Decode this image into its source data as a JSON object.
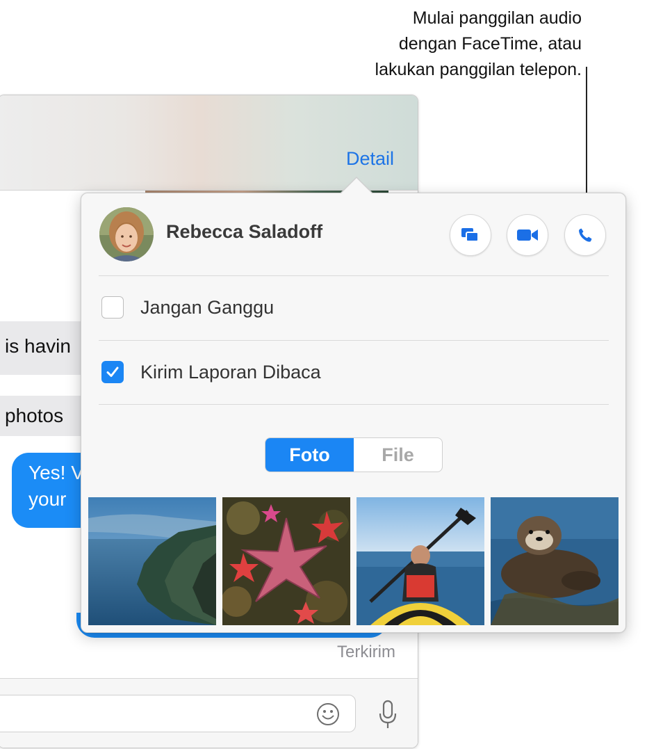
{
  "callout": {
    "line1": "Mulai panggilan audio",
    "line2": "dengan FaceTime, atau",
    "line3": "lakukan panggilan telepon."
  },
  "conversation": {
    "detail_label": "Detail",
    "received_1": "is havin",
    "received_2": "photos",
    "sent_line1": "Yes! V",
    "sent_line2": "your",
    "status": "Terkirim",
    "colors": {
      "sent_bubble": "#1b8cf6",
      "received_bubble": "#e9e9eb",
      "link": "#1d74e6"
    }
  },
  "details": {
    "contact_name": "Rebecca Saladoff",
    "actions": [
      {
        "icon": "screen-share-icon"
      },
      {
        "icon": "video-camera-icon"
      },
      {
        "icon": "phone-icon"
      }
    ],
    "options": {
      "do_not_disturb": {
        "label": "Jangan Ganggu",
        "checked": false
      },
      "read_receipts": {
        "label": "Kirim Laporan Dibaca",
        "checked": true
      }
    },
    "tabs": {
      "photos": "Foto",
      "files": "File",
      "selected": "Foto"
    },
    "attachments": [
      {
        "icon": "coast-photo"
      },
      {
        "icon": "starfish-photo"
      },
      {
        "icon": "kayak-photo"
      },
      {
        "icon": "sea-otter-photo"
      }
    ]
  }
}
